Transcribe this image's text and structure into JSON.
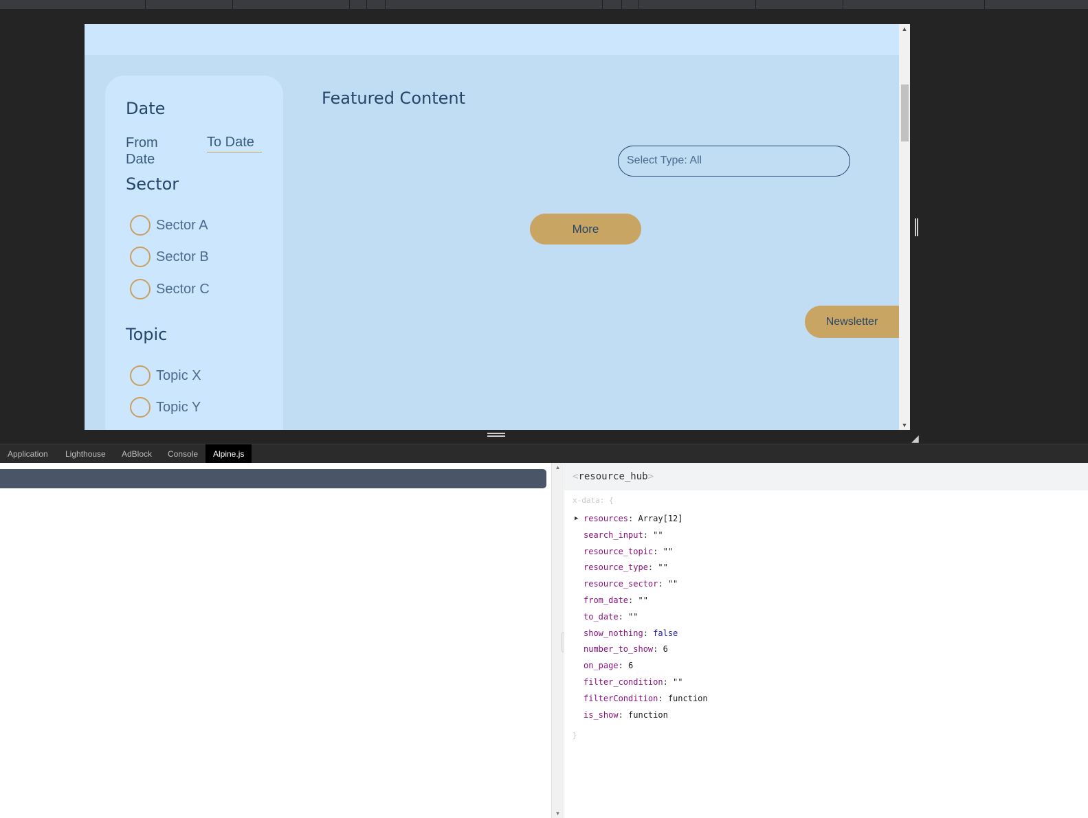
{
  "viewport": {
    "sidebar": {
      "date_heading": "Date",
      "from_date_label": "From Date",
      "to_date_label": "To Date",
      "sector_heading": "Sector",
      "sectors": [
        "Sector A",
        "Sector B",
        "Sector C"
      ],
      "topic_heading": "Topic",
      "topics": [
        "Topic X",
        "Topic Y"
      ]
    },
    "main": {
      "featured_title": "Featured Content",
      "select_type": "Select Type: All",
      "more_label": "More",
      "newsletter_label": "Newsletter"
    }
  },
  "colors": {
    "page_bg": "#c1ddf4",
    "card_bg": "#cce6fd",
    "accent_gold": "#c9a563",
    "heading_navy": "#26456b"
  },
  "devtools": {
    "tabs": [
      {
        "label": "Application",
        "active": false
      },
      {
        "label": "Lighthouse",
        "active": false
      },
      {
        "label": "AdBlock",
        "active": false
      },
      {
        "label": "Console",
        "active": false
      },
      {
        "label": "Alpine.js",
        "active": true
      }
    ],
    "component_name": "resource_hub",
    "xdata_open": "x-data: {",
    "xdata_close": "}",
    "properties": [
      {
        "key": "resources",
        "value": "Array[12]",
        "type": "array",
        "expandable": true
      },
      {
        "key": "search_input",
        "value": "\"\"",
        "type": "string"
      },
      {
        "key": "resource_topic",
        "value": "\"\"",
        "type": "string"
      },
      {
        "key": "resource_type",
        "value": "\"\"",
        "type": "string"
      },
      {
        "key": "resource_sector",
        "value": "\"\"",
        "type": "string"
      },
      {
        "key": "from_date",
        "value": "\"\"",
        "type": "string"
      },
      {
        "key": "to_date",
        "value": "\"\"",
        "type": "string"
      },
      {
        "key": "show_nothing",
        "value": "false",
        "type": "bool"
      },
      {
        "key": "number_to_show",
        "value": "6",
        "type": "number"
      },
      {
        "key": "on_page",
        "value": "6",
        "type": "number"
      },
      {
        "key": "filter_condition",
        "value": "\"\"",
        "type": "string"
      },
      {
        "key": "filterCondition",
        "value": "function",
        "type": "function"
      },
      {
        "key": "is_show",
        "value": "function",
        "type": "function"
      }
    ]
  }
}
